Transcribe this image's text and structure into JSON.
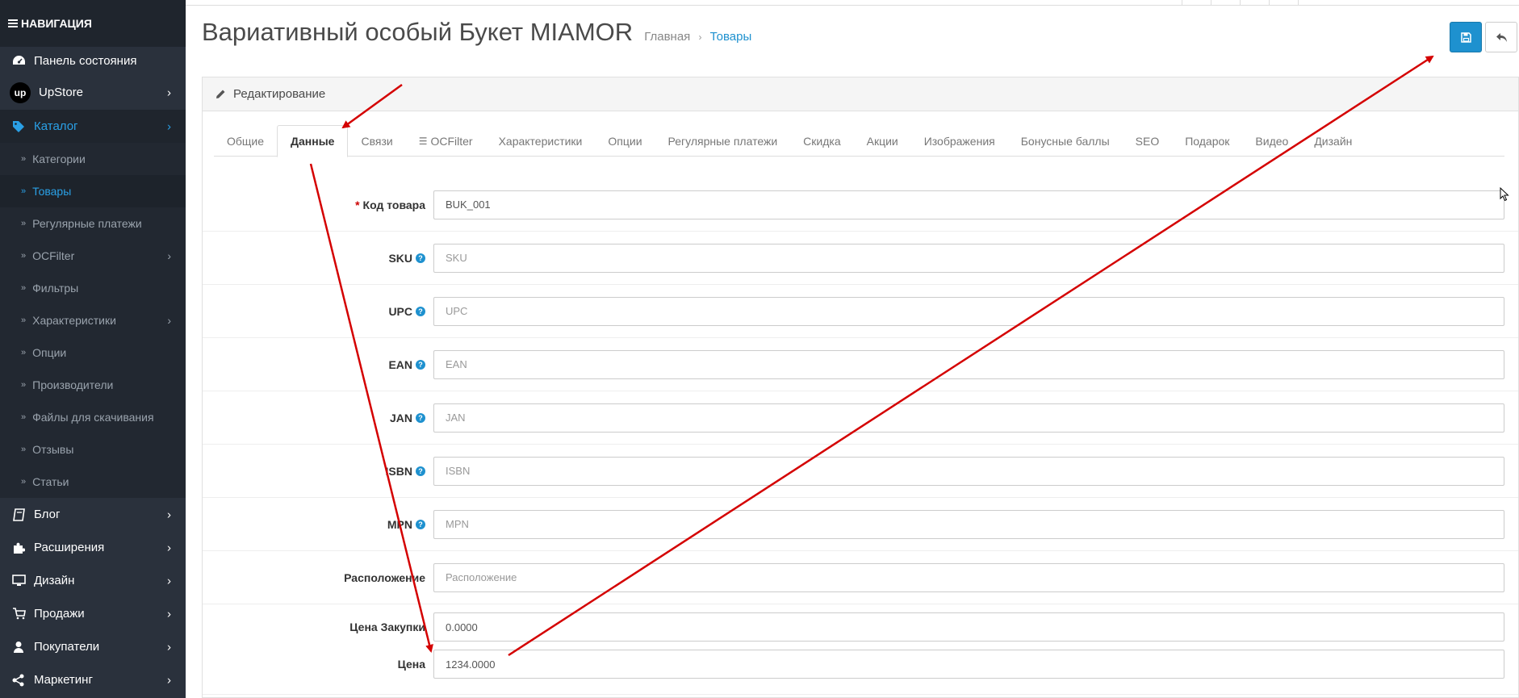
{
  "sidebar": {
    "header": "НАВИГАЦИЯ",
    "dashboard": "Панель состояния",
    "upstore": {
      "logo": "up",
      "label": "UpStore"
    },
    "catalog": "Каталог",
    "catalog_items": [
      {
        "label": "Категории"
      },
      {
        "label": "Товары"
      },
      {
        "label": "Регулярные платежи"
      },
      {
        "label": "OCFilter"
      },
      {
        "label": "Фильтры"
      },
      {
        "label": "Характеристики"
      },
      {
        "label": "Опции"
      },
      {
        "label": "Производители"
      },
      {
        "label": "Файлы для скачивания"
      },
      {
        "label": "Отзывы"
      },
      {
        "label": "Статьи"
      }
    ],
    "blog": "Блог",
    "extensions": "Расширения",
    "design": "Дизайн",
    "sales": "Продажи",
    "customers": "Покупатели",
    "marketing": "Маркетинг"
  },
  "header": {
    "title": "Вариативный особый Букет MIAMOR",
    "breadcrumb_home": "Главная",
    "breadcrumb_sep": "›",
    "breadcrumb_current": "Товары"
  },
  "panel": {
    "title": "Редактирование",
    "tabs": [
      "Общие",
      "Данные",
      "Связи",
      "OCFilter",
      "Характеристики",
      "Опции",
      "Регулярные платежи",
      "Скидка",
      "Акции",
      "Изображения",
      "Бонусные баллы",
      "SEO",
      "Подарок",
      "Видео",
      "Дизайн"
    ],
    "active_tab": "Данные"
  },
  "form": {
    "model": {
      "required_mark": "*",
      "label": "Код товара",
      "value": "BUK_001"
    },
    "sku": {
      "label": "SKU",
      "placeholder": "SKU",
      "help": "?"
    },
    "upc": {
      "label": "UPC",
      "placeholder": "UPC",
      "help": "?"
    },
    "ean": {
      "label": "EAN",
      "placeholder": "EAN",
      "help": "?"
    },
    "jan": {
      "label": "JAN",
      "placeholder": "JAN",
      "help": "?"
    },
    "isbn": {
      "label": "ISBN",
      "placeholder": "ISBN",
      "help": "?"
    },
    "mpn": {
      "label": "MPN",
      "placeholder": "MPN",
      "help": "?"
    },
    "location": {
      "label": "Расположение",
      "placeholder": "Расположение"
    },
    "purchase_price": {
      "label": "Цена Закупки",
      "value": "0.0000"
    },
    "price": {
      "label": "Цена",
      "value": "1234.0000"
    }
  },
  "colors": {
    "sidebar_bg": "#2a313c",
    "accent": "#1e91cf",
    "annotation_arrow": "#d40000"
  }
}
